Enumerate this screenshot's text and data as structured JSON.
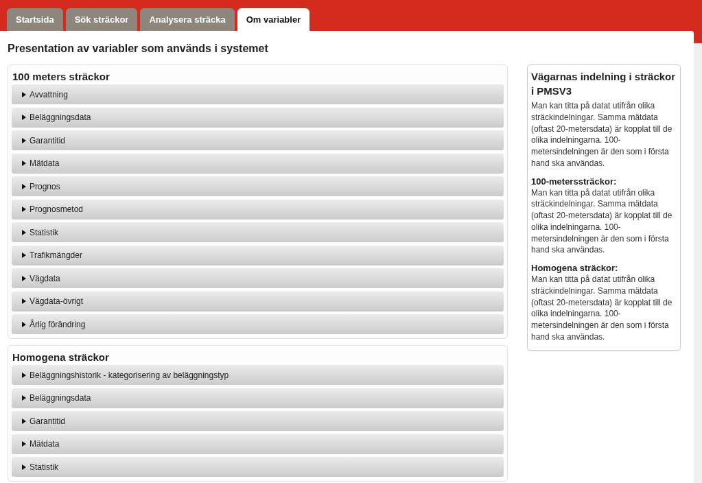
{
  "tabs": [
    {
      "label": "Startsida",
      "selected": false
    },
    {
      "label": "Sök sträckor",
      "selected": false
    },
    {
      "label": "Analysera sträcka",
      "selected": false
    },
    {
      "label": "Om variabler",
      "selected": true
    }
  ],
  "page_title": "Presentation av variabler som används i systemet",
  "sections": [
    {
      "title": "100 meters sträckor",
      "items": [
        {
          "label": "Avvattning",
          "expanded": false
        },
        {
          "label": "Beläggningsdata",
          "expanded": false
        },
        {
          "label": "Garantitid",
          "expanded": false
        },
        {
          "label": "Mätdata",
          "expanded": false
        },
        {
          "label": "Prognos",
          "expanded": false
        },
        {
          "label": "Prognosmetod",
          "expanded": false
        },
        {
          "label": "Statistik",
          "expanded": false
        },
        {
          "label": "Trafikmängder",
          "expanded": false
        },
        {
          "label": "Vägdata",
          "expanded": false
        },
        {
          "label": "Vägdata-övrigt",
          "expanded": false
        },
        {
          "label": "Årlig förändring",
          "expanded": false
        }
      ]
    },
    {
      "title": "Homogena sträckor",
      "items": [
        {
          "label": "Beläggningshistorik - kategorisering av beläggningstyp",
          "expanded": false
        },
        {
          "label": "Beläggningsdata",
          "expanded": false
        },
        {
          "label": "Garantitid",
          "expanded": false
        },
        {
          "label": "Mätdata",
          "expanded": false
        },
        {
          "label": "Statistik",
          "expanded": false
        }
      ]
    }
  ],
  "info_box": {
    "title": "Vägarnas indelning i sträckor i PMSV3",
    "blocks": [
      {
        "text": "Man kan titta på datat utifrån olika sträckindelningar. Samma mätdata (oftast 20-metersdata) är kopplat till de olika indelningarna. 100-metersindelningen är den som i första hand ska användas."
      },
      {
        "heading": "100-meterssträckor:",
        "text": "Man kan titta på datat utifrån olika sträckindelningar. Samma mätdata (oftast 20-metersdata) är kopplat till de olika indelningarna. 100-metersindelningen är den som i första hand ska användas."
      },
      {
        "heading": "Homogena sträckor:",
        "text": "Man kan titta på datat utifrån olika sträckindelningar. Samma mätdata (oftast 20-metersdata) är kopplat till de olika indelningarna. 100-metersindelningen är den som i första hand ska användas."
      }
    ]
  }
}
